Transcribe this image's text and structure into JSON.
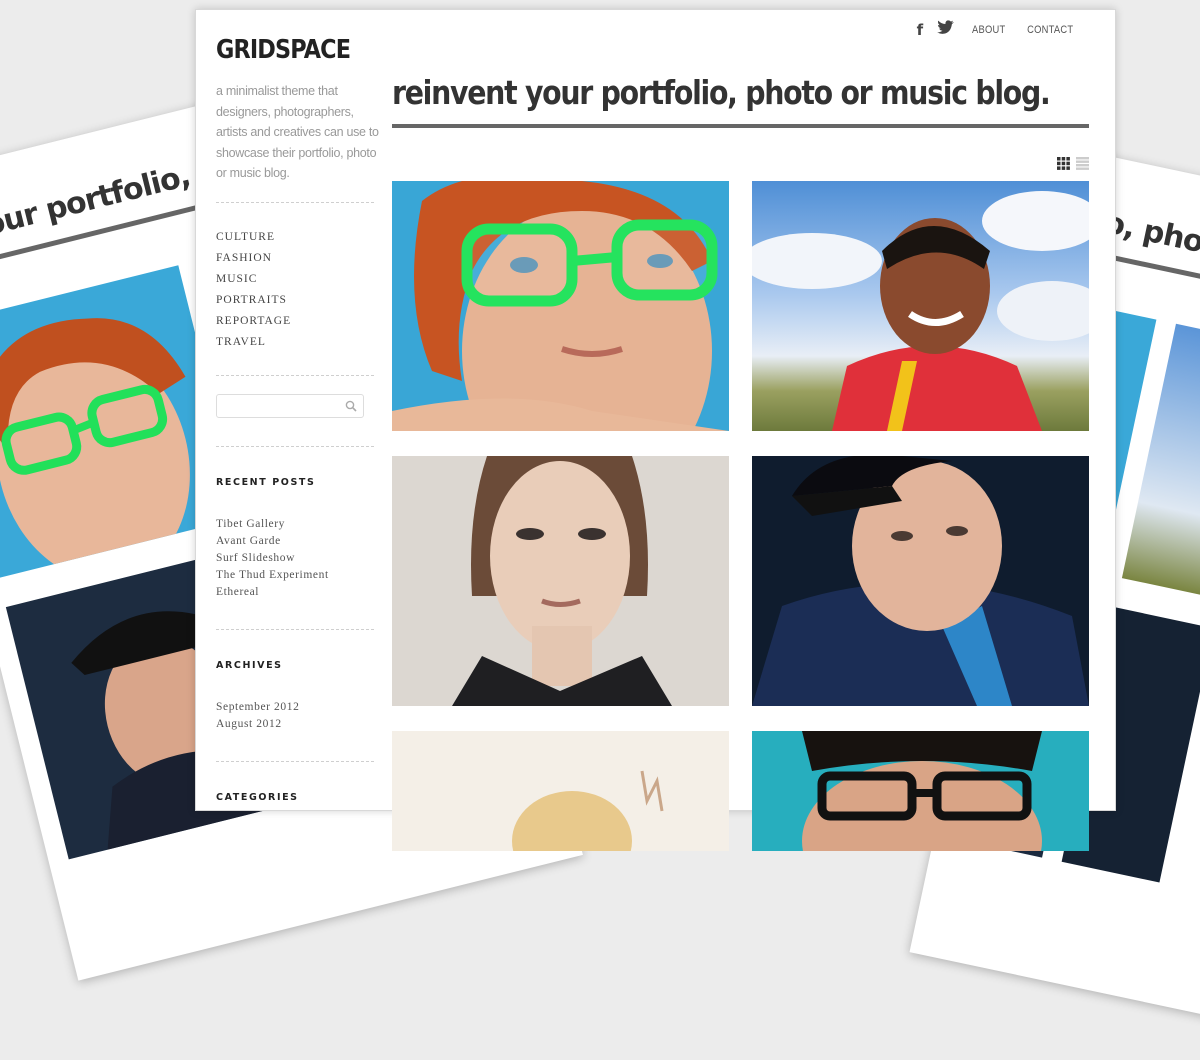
{
  "site": {
    "logo": "GRIDSPACE",
    "tagline": "a minimalist theme that designers, photographers, artists and creatives can use to showcase their portfolio, photo or music blog."
  },
  "topnav": {
    "facebook_icon": "facebook-icon",
    "twitter_icon": "twitter-icon",
    "about": "ABOUT",
    "contact": "CONTACT"
  },
  "headline": "reinvent your portfolio, photo or music blog.",
  "ghost_headline": "nt your portfolio, pl",
  "ghost_headline_right": "io, pho",
  "categories_nav": [
    "CULTURE",
    "FASHION",
    "MUSIC",
    "PORTRAITS",
    "REPORTAGE",
    "TRAVEL"
  ],
  "search": {
    "placeholder": "",
    "icon": "search-icon"
  },
  "recent_posts": {
    "title": "RECENT POSTS",
    "items": [
      "Tibet Gallery",
      "Avant Garde",
      "Surf Slideshow",
      "The Thud Experiment",
      "Ethereal"
    ]
  },
  "archives": {
    "title": "ARCHIVES",
    "items": [
      "September 2012",
      "August 2012"
    ]
  },
  "categories_widget": {
    "title": "CATEGORIES"
  },
  "view_toggle": {
    "grid_icon": "grid-view-icon",
    "list_icon": "list-view-icon"
  },
  "colors": {
    "headline_rule": "#666666",
    "text": "#333333",
    "accent_green": "#22e05a"
  }
}
